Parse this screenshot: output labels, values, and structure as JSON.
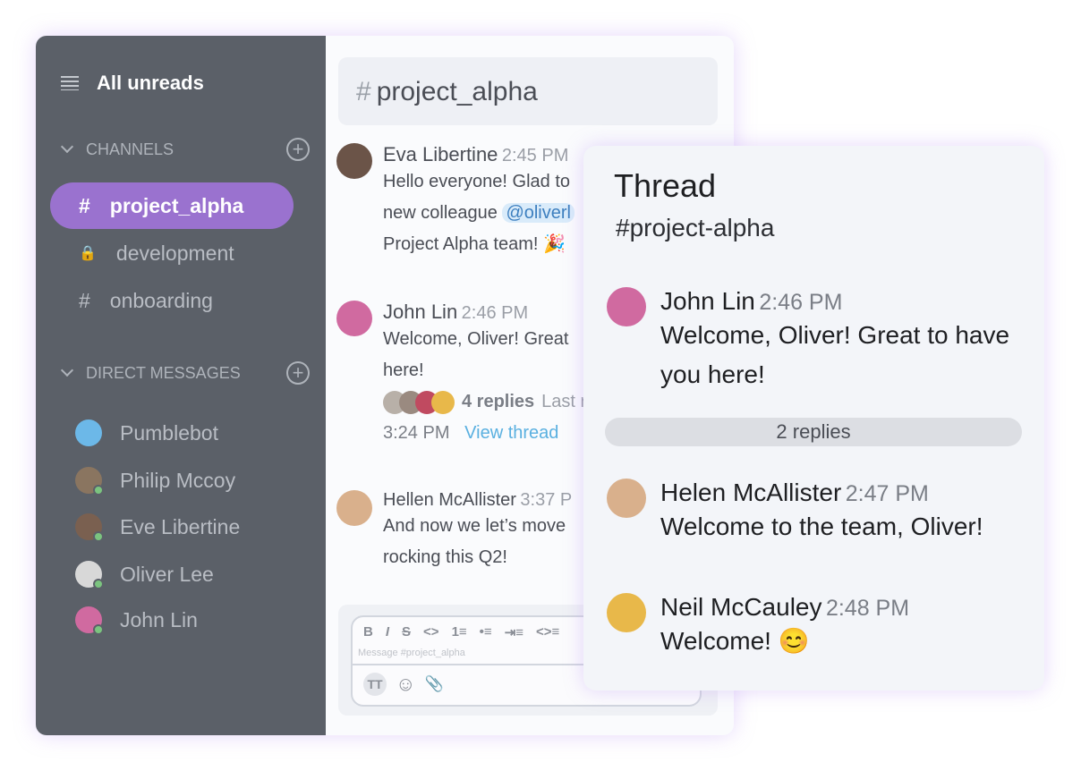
{
  "sidebar": {
    "all_unreads": "All unreads",
    "channels_label": "CHANNELS",
    "dm_label": "DIRECT MESSAGES",
    "channels": [
      {
        "name": "project_alpha",
        "icon": "hash"
      },
      {
        "name": "development",
        "icon": "lock"
      },
      {
        "name": "onboarding",
        "icon": "hash"
      }
    ],
    "dms": [
      {
        "name": "Pumblebot",
        "color": "#6cb8e8"
      },
      {
        "name": "Philip Mccoy",
        "color": "#8a7560"
      },
      {
        "name": "Eve Libertine",
        "color": "#7a6050"
      },
      {
        "name": "Oliver Lee",
        "color": "#d8d8d8"
      },
      {
        "name": "John Lin",
        "color": "#d06aa0"
      }
    ]
  },
  "channel": {
    "hash": "#",
    "title": "project_alpha"
  },
  "messages": [
    {
      "name": "Eva Libertine",
      "time": "2:45 PM",
      "lines": [
        "Hello everyone! Glad to",
        "new colleague ",
        "Project Alpha team! 🎉"
      ],
      "mention": "@oliverl",
      "color": "#6b5448"
    },
    {
      "name": "John Lin",
      "time": "2:46 PM",
      "lines": [
        "Welcome, Oliver! Great",
        "here!"
      ],
      "replies": "4 replies",
      "last": "Last r",
      "last_time": "3:24 PM",
      "view": "View thread",
      "color": "#d06aa0"
    },
    {
      "name": "Hellen McAllister",
      "time": "3:37 P",
      "lines": [
        "And now we let’s move",
        "rocking this Q2!"
      ],
      "color": "#d9b08c"
    }
  ],
  "composer": {
    "tools": [
      "B",
      "I",
      "S",
      "<>",
      "1≡",
      "•≡",
      "⇥≡",
      "<>≡"
    ],
    "placeholder": "Message #project_alpha",
    "tt": "TT",
    "emoji": "☺",
    "attach": "📎"
  },
  "thread": {
    "title": "Thread",
    "channel": "#project-alpha",
    "replies": "2 replies",
    "messages": [
      {
        "name": "John Lin",
        "time": "2:46 PM",
        "text": "Welcome, Oliver! Great to have you here!",
        "color": "#d06aa0"
      },
      {
        "name": "Helen McAllister",
        "time": "2:47 PM",
        "text": "Welcome to the team, Oliver!",
        "color": "#d9b08c"
      },
      {
        "name": "Neil McCauley",
        "time": "2:48 PM",
        "text": "Welcome! 😊",
        "color": "#e8b84a"
      }
    ]
  }
}
